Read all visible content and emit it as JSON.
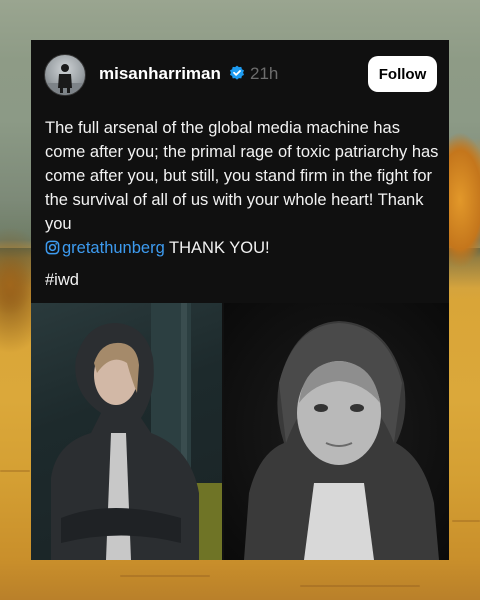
{
  "post": {
    "username": "misanharriman",
    "time": "21h",
    "follow_label": "Follow",
    "text_before": "The full arsenal of the global media machine has come after you; the primal rage of toxic patriarchy has come after you, but still, you stand firm in the fight for the survival of all of us with your whole heart! Thank you",
    "mention": "gretathunberg",
    "text_after": " THANK YOU!",
    "hashtag": "#iwd"
  },
  "icons": {
    "verified": "verified-badge-icon",
    "instagram": "instagram-icon"
  },
  "colors": {
    "card_bg": "#101010",
    "mention": "#3d9bf0",
    "verified": "#1d9bf0",
    "time": "#6d6d6d"
  }
}
